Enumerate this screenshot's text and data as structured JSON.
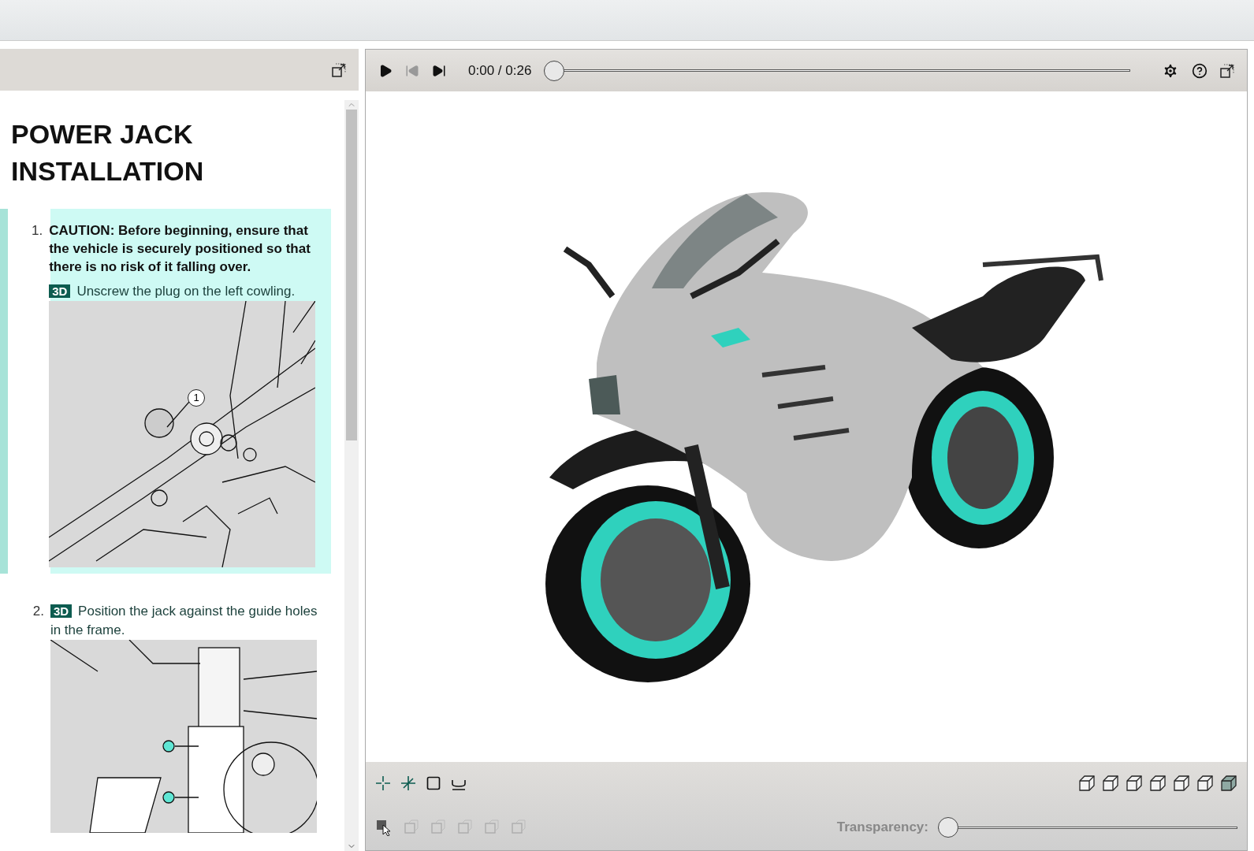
{
  "document": {
    "title": "POWER JACK INSTALLATION",
    "steps": [
      {
        "number": "1.",
        "selected": true,
        "caution": "CAUTION: Before beginning, ensure that the vehicle is securely positioned so that there is no risk of it falling over.",
        "badge": "3D",
        "text": "Unscrew the plug on the left cowling.",
        "callout": "1"
      },
      {
        "number": "2.",
        "selected": false,
        "badge": "3D",
        "text": "Position the jack against the guide holes in the frame."
      }
    ]
  },
  "player": {
    "time": "0:00",
    "separator": "/",
    "duration": "0:26",
    "level": 0
  },
  "viewer": {
    "transparency_label": "Transparency:",
    "transparency": {
      "level": 0
    }
  }
}
